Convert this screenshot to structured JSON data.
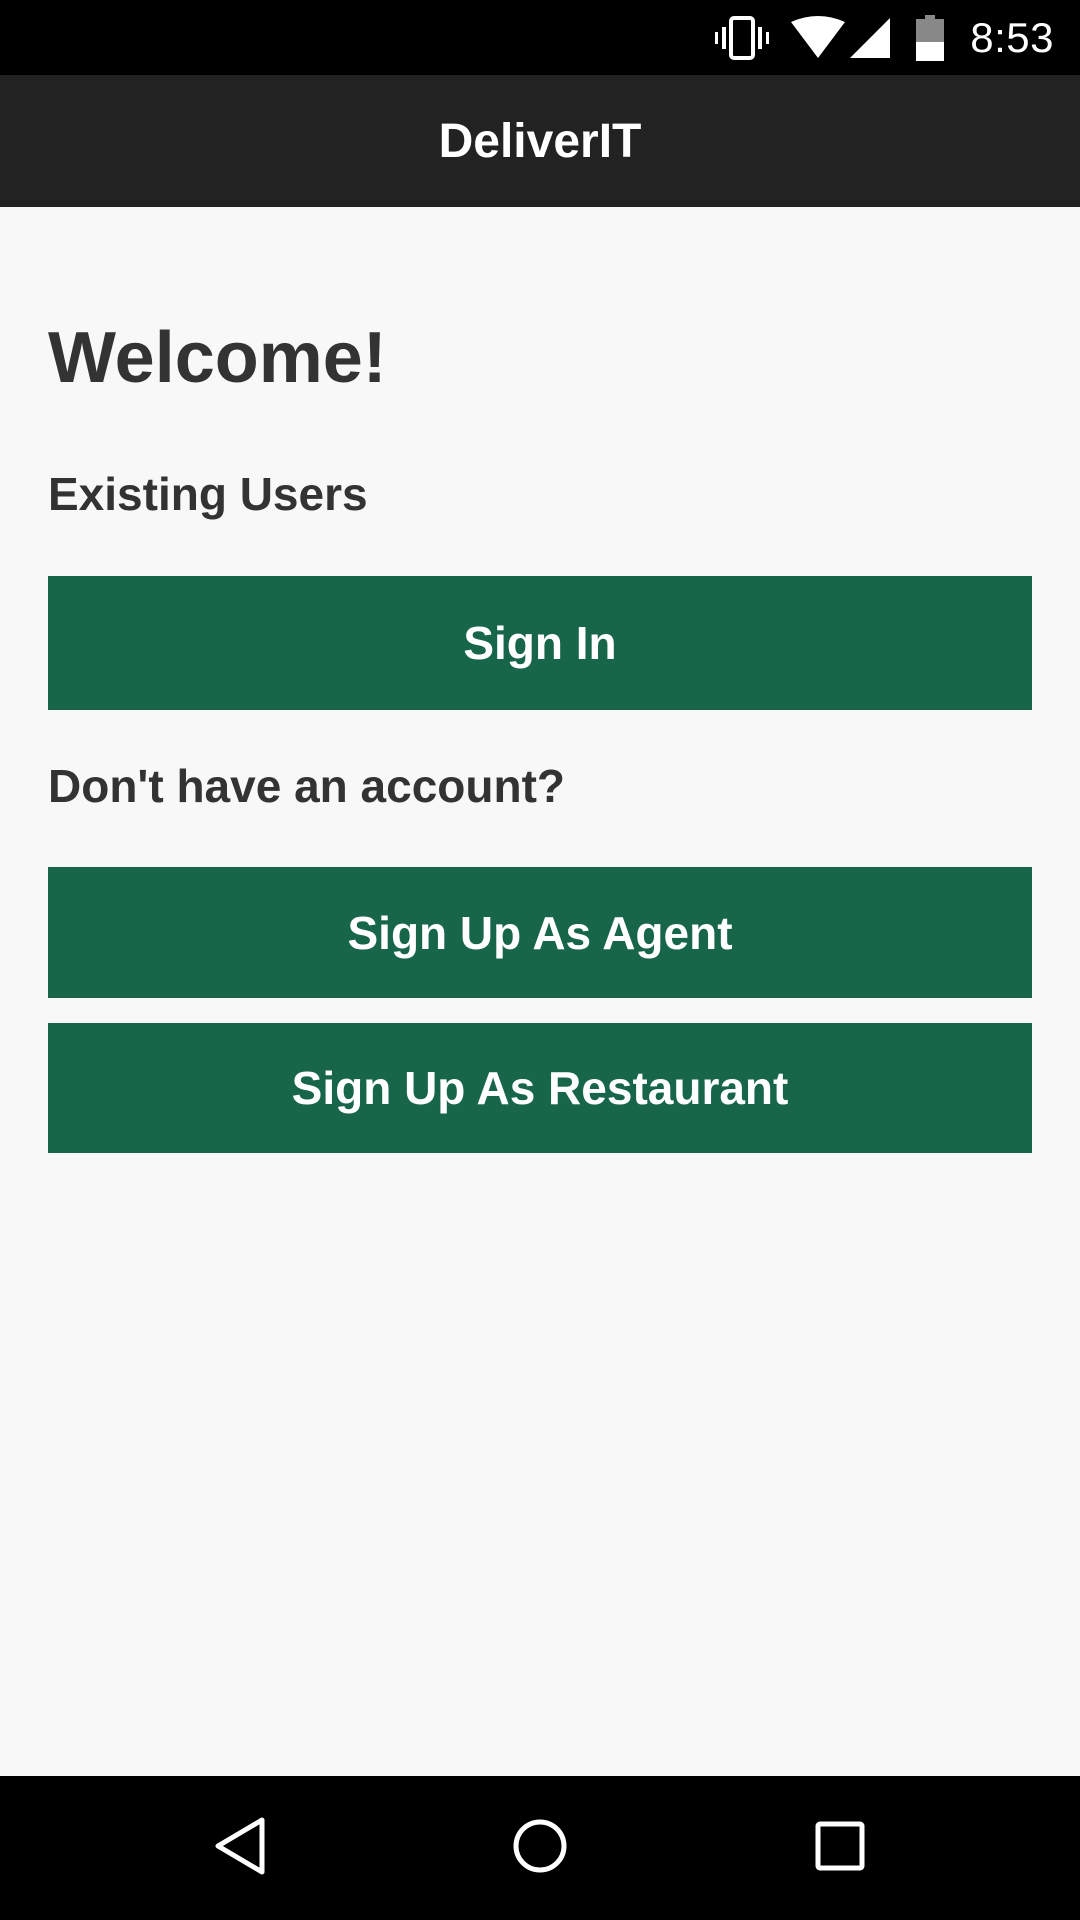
{
  "status_bar": {
    "time": "8:53",
    "icons": [
      "vibrate-icon",
      "wifi-icon",
      "signal-icon",
      "battery-icon"
    ],
    "battery_level": 0.45
  },
  "app_bar": {
    "title": "DeliverIT"
  },
  "main": {
    "welcome": "Welcome!",
    "existing_users_label": "Existing Users",
    "sign_in_label": "Sign In",
    "no_account_label": "Don't have an account?",
    "sign_up_agent_label": "Sign Up As Agent",
    "sign_up_restaurant_label": "Sign Up As Restaurant"
  },
  "nav_bar": {
    "icons": [
      "back-icon",
      "home-icon",
      "recents-icon"
    ]
  },
  "colors": {
    "status_bar_bg": "#000000",
    "app_bar_bg": "#222222",
    "background": "#f8f8f8",
    "button_bg": "#18664a",
    "button_text": "#ffffff",
    "heading_text": "#333333"
  }
}
